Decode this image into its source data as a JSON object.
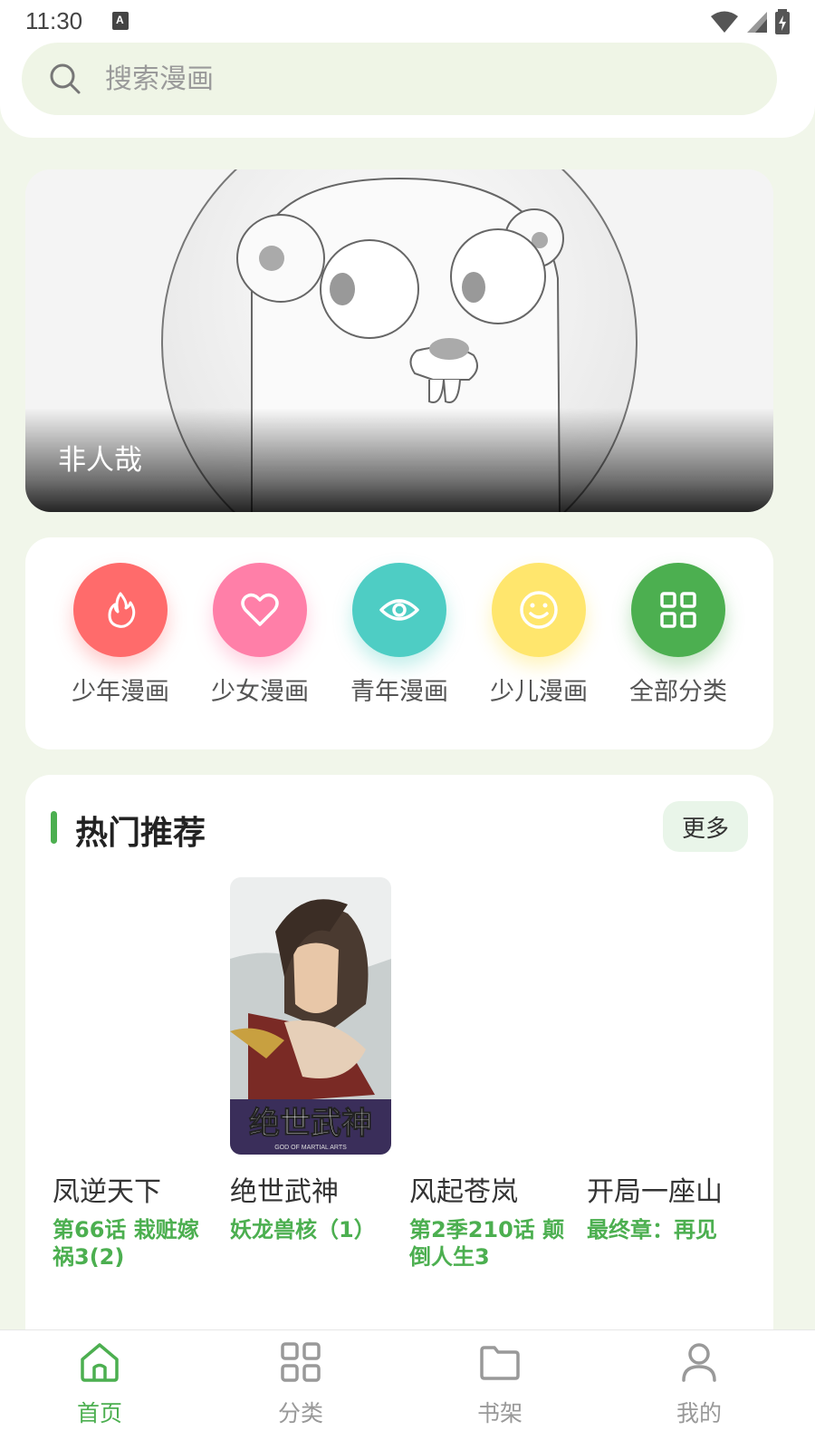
{
  "status_bar": {
    "time": "11:30",
    "notification_icon": "a-icon"
  },
  "search": {
    "placeholder": "搜索漫画"
  },
  "banner": {
    "title": "非人哉"
  },
  "categories": [
    {
      "label": "少年漫画",
      "icon": "flame-icon",
      "color": "#ff6b6b"
    },
    {
      "label": "少女漫画",
      "icon": "heart-icon",
      "color": "#ff7fa8"
    },
    {
      "label": "青年漫画",
      "icon": "eye-icon",
      "color": "#4ecdc4"
    },
    {
      "label": "少儿漫画",
      "icon": "smile-icon",
      "color": "#ffe66d"
    },
    {
      "label": "全部分类",
      "icon": "grid-icon",
      "color": "#4caf50"
    }
  ],
  "recommend": {
    "title": "热门推荐",
    "more_label": "更多",
    "comics": [
      {
        "title": "凤逆天下",
        "chapter": "第66话 栽赃嫁祸3(2)"
      },
      {
        "title": "绝世武神",
        "chapter": "妖龙兽核（1）",
        "cover_text": "绝世武神",
        "cover_subtext": "GOD OF MARTIAL ARTS"
      },
      {
        "title": "风起苍岚",
        "chapter": "第2季210话 颠倒人生3"
      },
      {
        "title": "开局一座山",
        "chapter": "最终章：再见"
      }
    ]
  },
  "nav": [
    {
      "label": "首页",
      "icon": "home-icon",
      "active": true
    },
    {
      "label": "分类",
      "icon": "grid-icon",
      "active": false
    },
    {
      "label": "书架",
      "icon": "folder-icon",
      "active": false
    },
    {
      "label": "我的",
      "icon": "user-icon",
      "active": false
    }
  ],
  "colors": {
    "accent": "#4caf50",
    "background": "#f1f6ea"
  }
}
